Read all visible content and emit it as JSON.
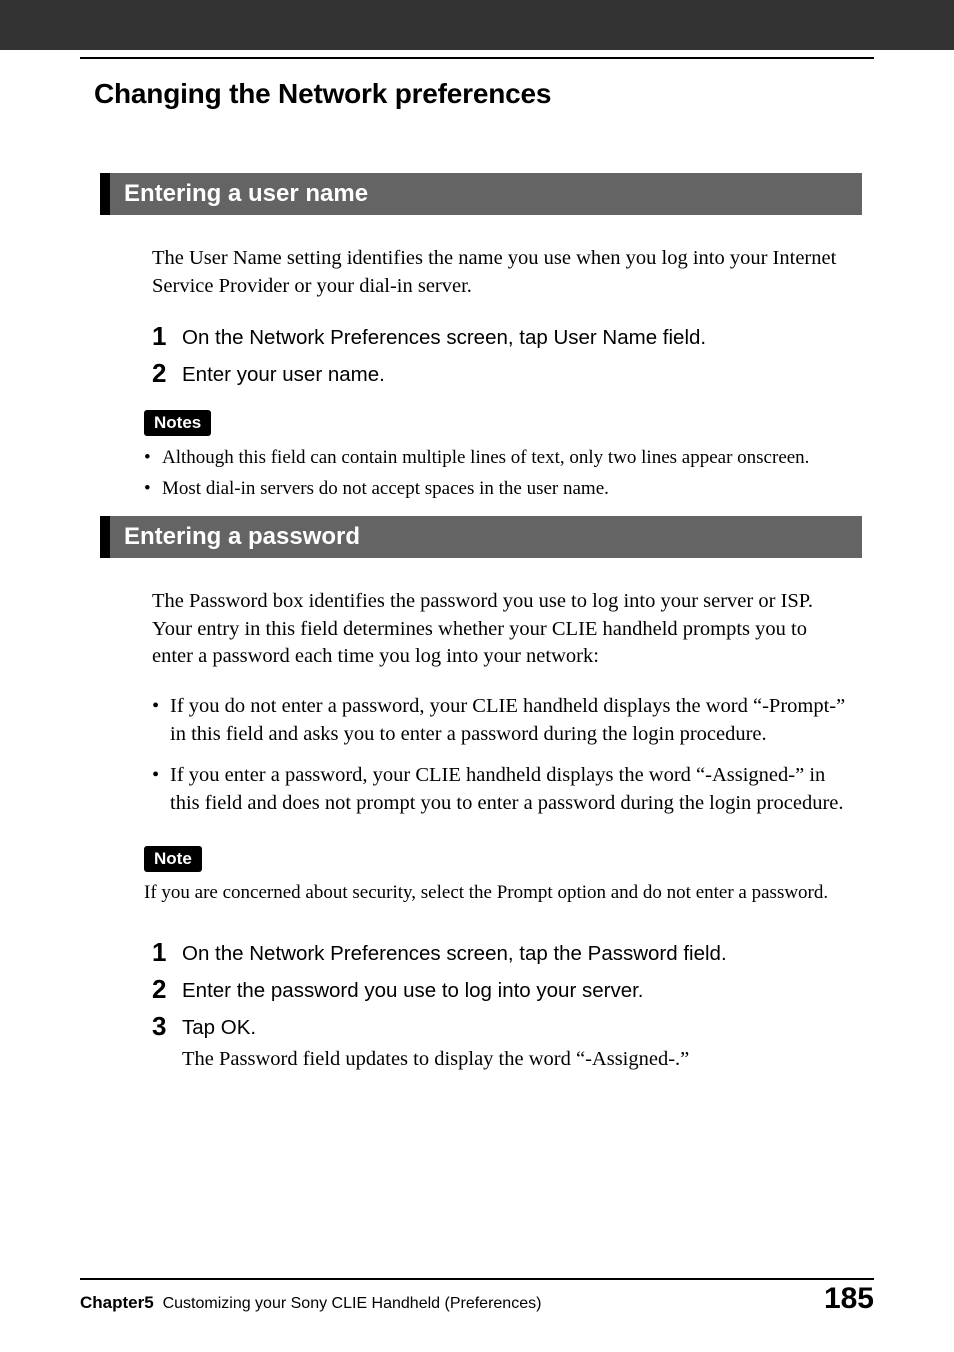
{
  "header": {
    "title": "Changing the Network preferences"
  },
  "section1": {
    "title": "Entering a user name",
    "intro": "The User Name setting identifies the name you use when you log into your Internet Service Provider or your dial-in server.",
    "steps": [
      {
        "num": "1",
        "text": "On the Network Preferences screen, tap User Name field."
      },
      {
        "num": "2",
        "text": "Enter your user name."
      }
    ],
    "notes_label": "Notes",
    "notes": [
      "Although this field can contain multiple lines of text, only two lines appear onscreen.",
      "Most dial-in servers do not accept spaces in the user name."
    ]
  },
  "section2": {
    "title": "Entering a password",
    "intro": "The Password box identifies the password you use to log into your server or ISP. Your entry in this field determines whether your CLIE handheld prompts you to enter a password each time you log into your network:",
    "bullets": [
      "If you do not enter a password, your CLIE handheld displays the word “-Prompt-” in this field and asks you to enter a password during the login procedure.",
      "If you enter a password, your CLIE handheld displays the word “-Assigned-” in this field and does not prompt you to enter a password during the login procedure."
    ],
    "note_label": "Note",
    "note_text": "If you are concerned about security, select the Prompt option and do not enter a password.",
    "steps": [
      {
        "num": "1",
        "text": "On the Network Preferences screen, tap the Password field."
      },
      {
        "num": "2",
        "text": "Enter the password you use to log into your server."
      },
      {
        "num": "3",
        "text": "Tap OK.",
        "extra": "The Password field updates to display the word “-Assigned-.”"
      }
    ]
  },
  "footer": {
    "chapter_label": "Chapter5",
    "chapter_text": "Customizing your Sony CLIE Handheld (Preferences)",
    "page_number": "185"
  }
}
